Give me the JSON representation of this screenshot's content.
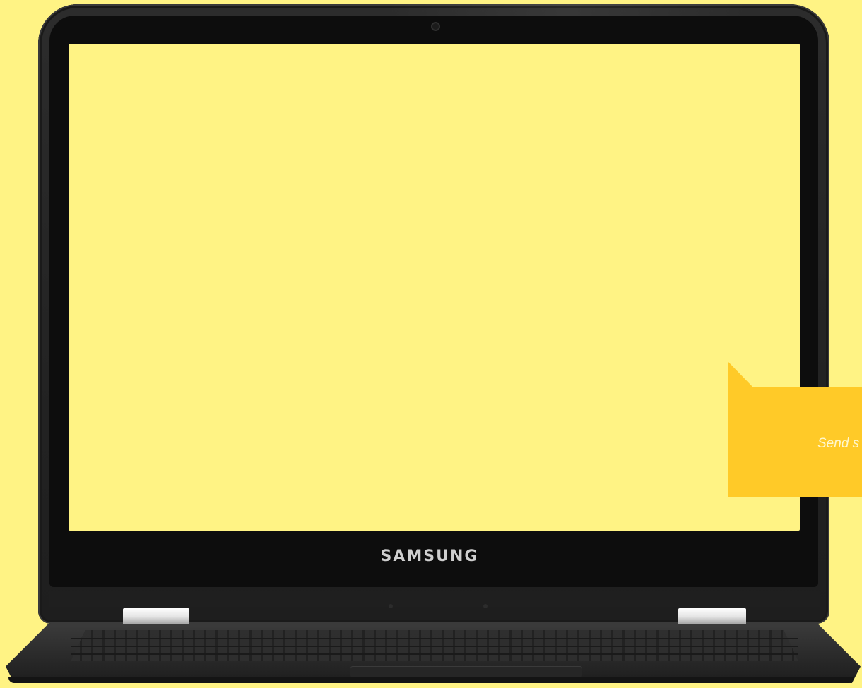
{
  "device": {
    "brand_label": "SAMSUNG"
  },
  "callout": {
    "text": "Send s"
  },
  "colors": {
    "background": "#fff384",
    "screen": "#fff384",
    "callout": "#ffca28",
    "bezel": "#232323"
  },
  "icons": {
    "camera": "camera-icon"
  }
}
